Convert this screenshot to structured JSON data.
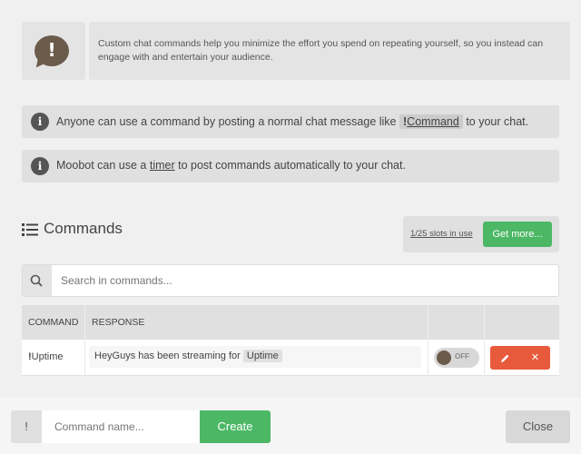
{
  "intro": {
    "icon": "speech-bubble-exclamation-icon",
    "mark": "!",
    "text": "Custom chat commands help you minimize the effort you spend on repeating yourself, so you instead can engage with and entertain your audience."
  },
  "usage": {
    "row1": {
      "icon": "info-icon",
      "icon_glyph": "i",
      "before": "Anyone can use a command by posting a normal chat message like",
      "code_prefix": "!",
      "code_name": "Command",
      "after": "to your chat."
    },
    "row2": {
      "icon": "info-icon",
      "icon_glyph": "i",
      "before": "Moobot can use a",
      "link": "timer",
      "after": "to post commands automatically to your chat."
    }
  },
  "commands": {
    "title": "Commands",
    "title_icon": "list-icon",
    "slots": "1/25 slots in use",
    "get_more": "Get more...",
    "search": {
      "placeholder": "Search in commands...",
      "icon": "search-icon"
    },
    "columns": [
      "COMMAND",
      "RESPONSE"
    ],
    "rows": [
      {
        "prefix": "!",
        "name": "Uptime",
        "response_text": "HeyGuys has been streaming for",
        "response_var": "Uptime",
        "toggle": "OFF",
        "edit_icon": "pencil-icon",
        "delete_icon": "close-icon",
        "delete_glyph": "✕"
      }
    ]
  },
  "footer": {
    "prefix": "!",
    "name_placeholder": "Command name...",
    "create": "Create",
    "close": "Close"
  },
  "colors": {
    "green": "#4cb866",
    "red": "#e85a3c",
    "brown": "#6b5b4b"
  }
}
